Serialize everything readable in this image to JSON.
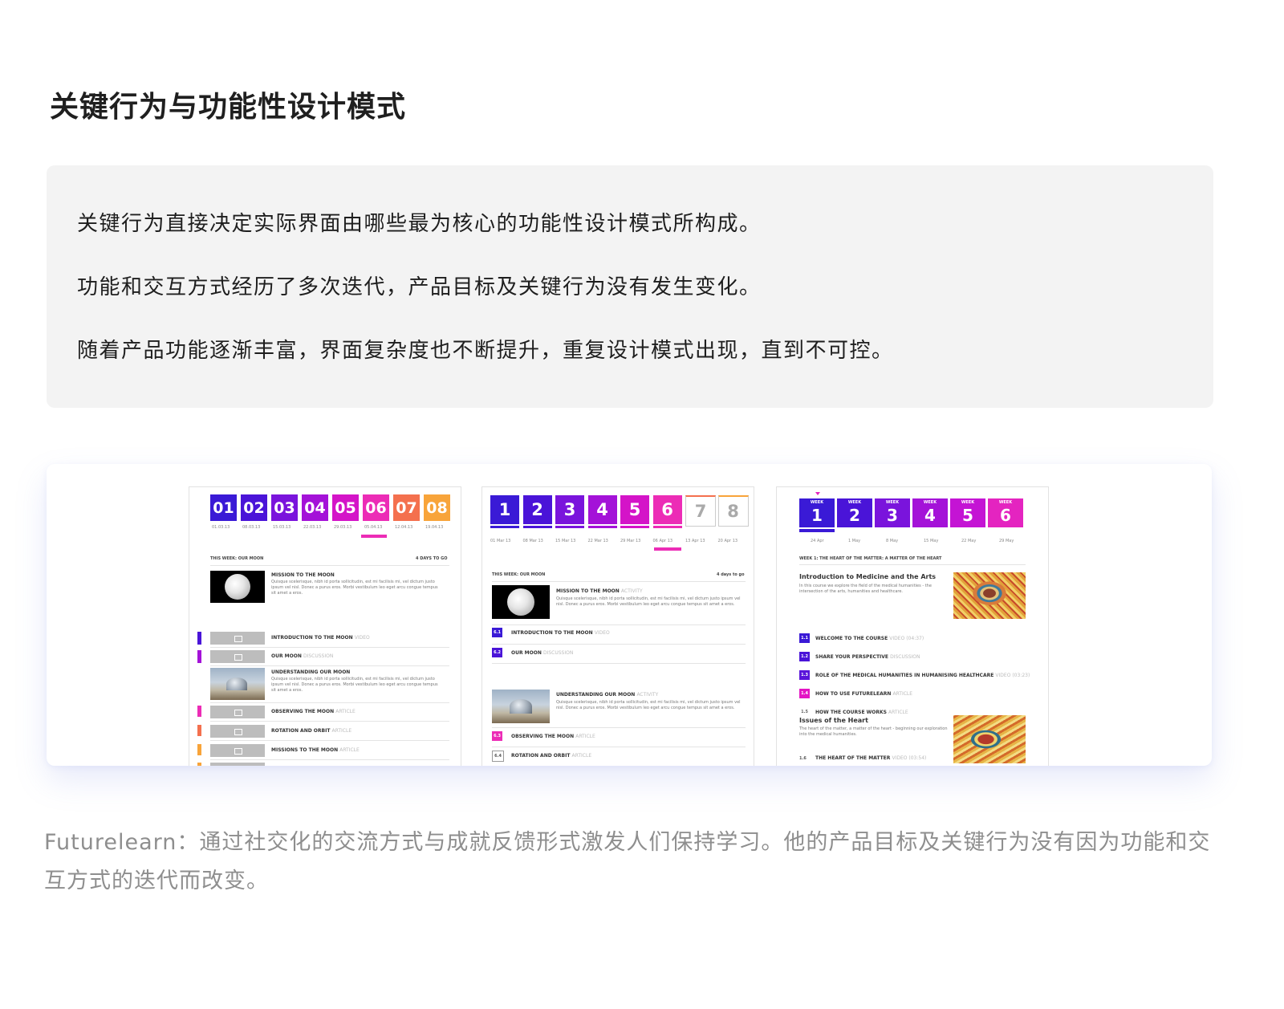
{
  "heading": "关键行为与功能性设计模式",
  "quote": {
    "line1": "关键行为直接决定实际界面由哪些最为核心的功能性设计模式所构成。",
    "line2": "功能和交互方式经历了多次迭代，产品目标及关键行为没有发生变化。",
    "line3": "随着产品功能逐渐丰富，界面复杂度也不断提升，重复设计模式出现，直到不可控。"
  },
  "caption": "Futurelearn：通过社交化的交流方式与成就反馈形式激发人们保持学习。他的产品目标及关键行为没有因为功能和交互方式的迭代而改变。",
  "panel1": {
    "numbers": [
      "01",
      "02",
      "03",
      "04",
      "05",
      "06",
      "07",
      "08"
    ],
    "colors": [
      "#3a1ad6",
      "#4a14d8",
      "#7a14dc",
      "#a412d8",
      "#d414c8",
      "#ec2cb6",
      "#f4704e",
      "#f8a43a"
    ],
    "dates": [
      "01.03.13",
      "08.03.13",
      "15.03.13",
      "22.03.13",
      "29.03.13",
      "05.04.13",
      "12.04.13",
      "19.04.13"
    ],
    "week_label": "THIS WEEK: OUR MOON",
    "days_left": "4 DAYS TO GO",
    "item1_title": "MISSION TO THE MOON",
    "item1_text": "Quisque scelerisque, nibh id porta sollicitudin, est mi facilisis mi, vel dictum justo ipsum vel nisl. Donec a purus eros. Morbi vestibulum leo eget arcu congue tempus sit amet a eros.",
    "row1": "INTRODUCTION TO THE MOON",
    "row1_type": "VIDEO",
    "row2": "OUR MOON",
    "row2_type": "DISCUSSION",
    "item2_title": "UNDERSTANDING OUR MOON",
    "item2_text": "Quisque scelerisque, nibh id porta sollicitudin, est mi facilisis mi, vel dictum justo ipsum vel nisl. Donec a purus eros. Morbi vestibulum leo eget arcu congue tempus sit amet a eros.",
    "row3": "OBSERVING THE MOON",
    "row3_type": "ARTICLE",
    "row4": "ROTATION AND ORBIT",
    "row4_type": "ARTICLE",
    "row5": "MISSIONS TO THE MOON",
    "row5_type": "ARTICLE"
  },
  "panel2": {
    "numbers": [
      "1",
      "2",
      "3",
      "4",
      "5",
      "6",
      "7",
      "8"
    ],
    "colors": [
      "#3a1ad6",
      "#4a14d8",
      "#7a14dc",
      "#a412d8",
      "#d414c8",
      "#ec2cb6",
      "#ffffff",
      "#ffffff"
    ],
    "dates": [
      "01 Mar 13",
      "08 Mar 13",
      "15 Mar 13",
      "22 Mar 13",
      "29 Mar 13",
      "06 Apr 13",
      "13 Apr 13",
      "20 Apr 13"
    ],
    "week_label": "THIS WEEK: OUR MOON",
    "days_left": "4 days to go",
    "item1_title": "MISSION TO THE MOON",
    "item1_type": "ACTIVITY",
    "item1_text": "Quisque scelerisque, nibh id porta sollicitudin, est mi facilisis mi, vel dictum justo ipsum vel nisl. Donec a purus eros. Morbi vestibulum leo eget arcu congue tempus sit amet a eros.",
    "row1_num": "6.1",
    "row1": "INTRODUCTION TO THE MOON",
    "row1_type": "VIDEO",
    "row2_num": "6.2",
    "row2": "OUR MOON",
    "row2_type": "DISCUSSION",
    "item2_title": "UNDERSTANDING OUR MOON",
    "item2_type": "ACTIVITY",
    "item2_text": "Quisque scelerisque, nibh id porta sollicitudin, est mi facilisis mi, vel dictum justo ipsum vel nisl. Donec a purus eros. Morbi vestibulum leo eget arcu congue tempus sit amet a eros.",
    "row3_num": "6.3",
    "row3": "OBSERVING THE MOON",
    "row3_type": "ARTICLE",
    "row4_num": "6.4",
    "row4": "ROTATION AND ORBIT",
    "row4_type": "ARTICLE"
  },
  "panel3": {
    "week_word": "WEEK",
    "numbers": [
      "1",
      "2",
      "3",
      "4",
      "5",
      "6"
    ],
    "colors": [
      "#3a1ad6",
      "#4a14d8",
      "#7a14dc",
      "#a412d8",
      "#c414d4",
      "#e424c0"
    ],
    "dates": [
      "24 Apr",
      "1 May",
      "8 May",
      "15 May",
      "22 May",
      "29 May"
    ],
    "week_label": "WEEK 1: THE HEART OF THE MATTER: A MATTER OF THE HEART",
    "item1_title": "Introduction to Medicine and the Arts",
    "item1_text": "In this course we explore the field of the medical humanities - the intersection of the arts, humanities and healthcare.",
    "rows": [
      {
        "num": "1.1",
        "text": "WELCOME TO THE COURSE",
        "type": "VIDEO (04:37)",
        "color": "#3a1ad6"
      },
      {
        "num": "1.2",
        "text": "SHARE YOUR PERSPECTIVE",
        "type": "DISCUSSION",
        "color": "#4a14d8"
      },
      {
        "num": "1.3",
        "text": "ROLE OF THE MEDICAL HUMANITIES IN HUMANISING HEALTHCARE",
        "type": "VIDEO (03:23)",
        "color": "#5a14da"
      },
      {
        "num": "1.4",
        "text": "HOW TO USE FUTURELEARN",
        "type": "ARTICLE",
        "color": "#e414c4"
      },
      {
        "num": "1.5",
        "text": "HOW THE COURSE WORKS",
        "type": "ARTICLE",
        "color": "#ffffff"
      }
    ],
    "item2_title": "Issues of the Heart",
    "item2_text": "The heart of the matter, a matter of the heart - beginning our exploration into the medical humanities.",
    "row6_num": "1.6",
    "row6": "THE HEART OF THE MATTER",
    "row6_type": "VIDEO (03:54)"
  }
}
